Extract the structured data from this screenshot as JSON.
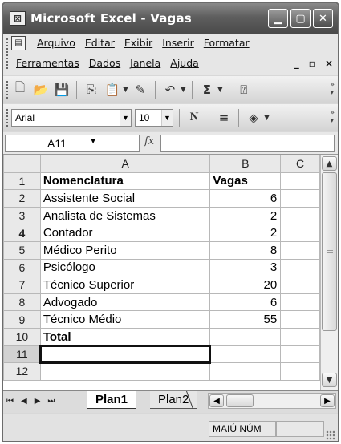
{
  "window": {
    "title": "Microsoft Excel - Vagas",
    "app_icon": "excel-icon",
    "minimize_icon": "minimize-icon",
    "maximize_icon": "maximize-icon",
    "close_icon": "close-icon"
  },
  "menu": {
    "row1": [
      "Arquivo",
      "Editar",
      "Exibir",
      "Inserir",
      "Formatar"
    ],
    "row2": [
      "Ferramentas",
      "Dados",
      "Janela",
      "Ajuda"
    ],
    "doc_minimize": "_",
    "doc_restore": "▫",
    "doc_close": "×"
  },
  "toolbar": {
    "icons": [
      "new-icon",
      "open-icon",
      "save-icon",
      "copy-icon",
      "paste-icon",
      "format-painter-icon",
      "undo-icon",
      "autosum-icon",
      "help-icon"
    ],
    "autosum_label": "Σ"
  },
  "formatting": {
    "font_name": "Arial",
    "font_size": "10",
    "bold_label": "N",
    "align_icon": "align-center-icon",
    "fill_icon": "fill-color-icon"
  },
  "formula_bar": {
    "cell_reference": "A11",
    "fx_label": "fx",
    "formula": ""
  },
  "sheet": {
    "columns": [
      "A",
      "B",
      "C"
    ],
    "rows": [
      {
        "num": "1",
        "a": "Nomenclatura",
        "b": "Vagas",
        "bold": true
      },
      {
        "num": "2",
        "a": "Assistente Social",
        "b": "6"
      },
      {
        "num": "3",
        "a": "Analista de Sistemas",
        "b": "2"
      },
      {
        "num": "4",
        "a": "Contador",
        "b": "2"
      },
      {
        "num": "5",
        "a": "Médico Perito",
        "b": "8"
      },
      {
        "num": "6",
        "a": "Psicólogo",
        "b": "3"
      },
      {
        "num": "7",
        "a": "Técnico Superior",
        "b": "20"
      },
      {
        "num": "8",
        "a": "Advogado",
        "b": "6"
      },
      {
        "num": "9",
        "a": "Técnico Médio",
        "b": "55"
      },
      {
        "num": "10",
        "a": "Total",
        "b": "",
        "bold": true
      },
      {
        "num": "11",
        "a": "",
        "b": "",
        "selected": true
      },
      {
        "num": "12",
        "a": "",
        "b": ""
      }
    ],
    "active_cell": "A11"
  },
  "tabs": {
    "active": "Plan1",
    "inactive": "Plan2"
  },
  "status": {
    "caps": "MAIÚ NÚM"
  }
}
